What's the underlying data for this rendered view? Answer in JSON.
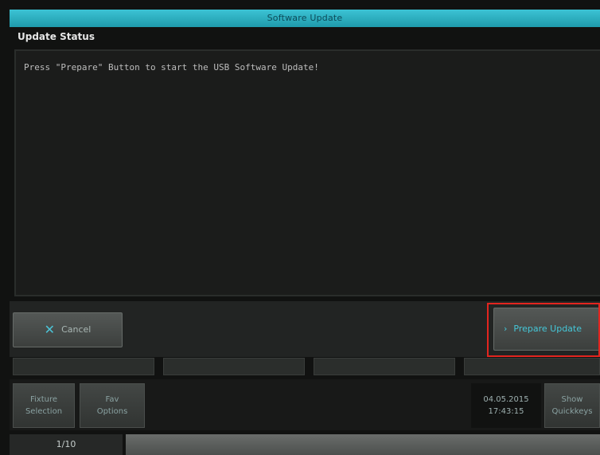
{
  "window": {
    "title": "Software Update"
  },
  "status": {
    "label": "Update Status",
    "message": "Press \"Prepare\" Button to start the USB Software Update!"
  },
  "actions": {
    "cancel_label": "Cancel",
    "prepare_label": "Prepare Update",
    "cancel_icon": "close-icon",
    "prepare_icon": "chevron-right-icon",
    "accent": "#45c7d8",
    "highlight_color": "#e3251f"
  },
  "footer": {
    "fixture_selection": [
      "Fixture",
      "Selection"
    ],
    "fav_options": [
      "Fav",
      "Options"
    ],
    "date": "04.05.2015",
    "time": "17:43:15",
    "show_quickkeys": [
      "Show",
      "Quickkeys"
    ],
    "pager": "1/10"
  }
}
